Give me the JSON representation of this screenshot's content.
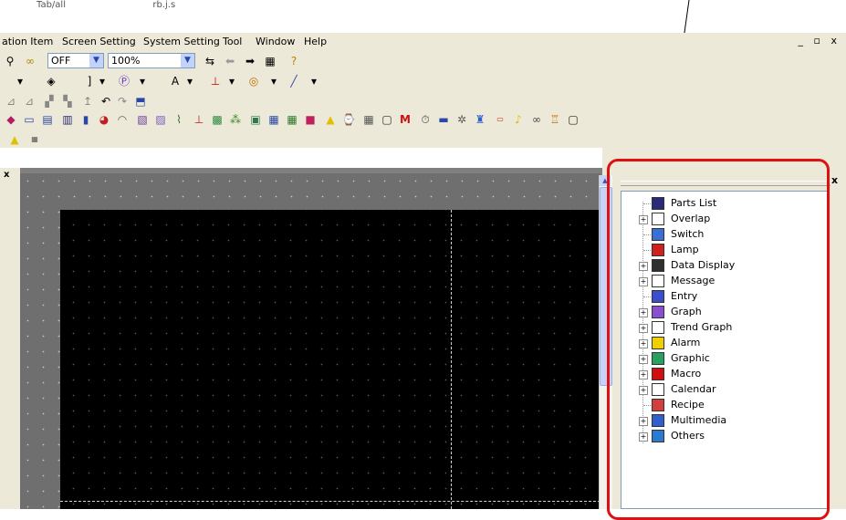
{
  "caption": {
    "left_text": "Tab/all",
    "mid_text": "rb.j.s"
  },
  "menu": {
    "items": [
      "ation Item",
      "Screen Setting",
      "System Setting",
      "Tool",
      "Window",
      "Help"
    ],
    "window_controls": "_ ▫ x"
  },
  "toolbar1": {
    "state_combo": "OFF",
    "zoom_combo": "100%"
  },
  "panel": {
    "close_label": "x",
    "left_close_label": "x"
  },
  "tree": {
    "items": [
      {
        "label": "Parts List",
        "expandable": false,
        "icon": "parts-list-icon",
        "color": "#2a2a7a"
      },
      {
        "label": "Overlap",
        "expandable": true,
        "icon": "overlap-icon",
        "color": "#ffffff"
      },
      {
        "label": "Switch",
        "expandable": false,
        "icon": "switch-icon",
        "color": "#3a6fd8"
      },
      {
        "label": "Lamp",
        "expandable": false,
        "icon": "lamp-icon",
        "color": "#d02020"
      },
      {
        "label": "Data Display",
        "expandable": true,
        "icon": "data-display-icon",
        "color": "#303030"
      },
      {
        "label": "Message",
        "expandable": true,
        "icon": "message-icon",
        "color": "#ffffff"
      },
      {
        "label": "Entry",
        "expandable": false,
        "icon": "entry-icon",
        "color": "#3a4fd0"
      },
      {
        "label": "Graph",
        "expandable": true,
        "icon": "graph-icon",
        "color": "#8a4fd0"
      },
      {
        "label": "Trend Graph",
        "expandable": true,
        "icon": "trend-graph-icon",
        "color": "#ffffff"
      },
      {
        "label": "Alarm",
        "expandable": true,
        "icon": "alarm-icon",
        "color": "#f0d000"
      },
      {
        "label": "Graphic",
        "expandable": true,
        "icon": "graphic-icon",
        "color": "#2aa060"
      },
      {
        "label": "Macro",
        "expandable": true,
        "icon": "macro-icon",
        "color": "#d01010"
      },
      {
        "label": "Calendar",
        "expandable": true,
        "icon": "calendar-icon",
        "color": "#ffffff"
      },
      {
        "label": "Recipe",
        "expandable": false,
        "icon": "recipe-icon",
        "color": "#d04040"
      },
      {
        "label": "Multimedia",
        "expandable": true,
        "icon": "multimedia-icon",
        "color": "#3060d0"
      },
      {
        "label": "Others",
        "expandable": true,
        "icon": "others-icon",
        "color": "#2a7ad0"
      }
    ]
  },
  "colors": {
    "highlight": "#e01010",
    "chrome": "#ece9d8",
    "screen": "#000000"
  }
}
